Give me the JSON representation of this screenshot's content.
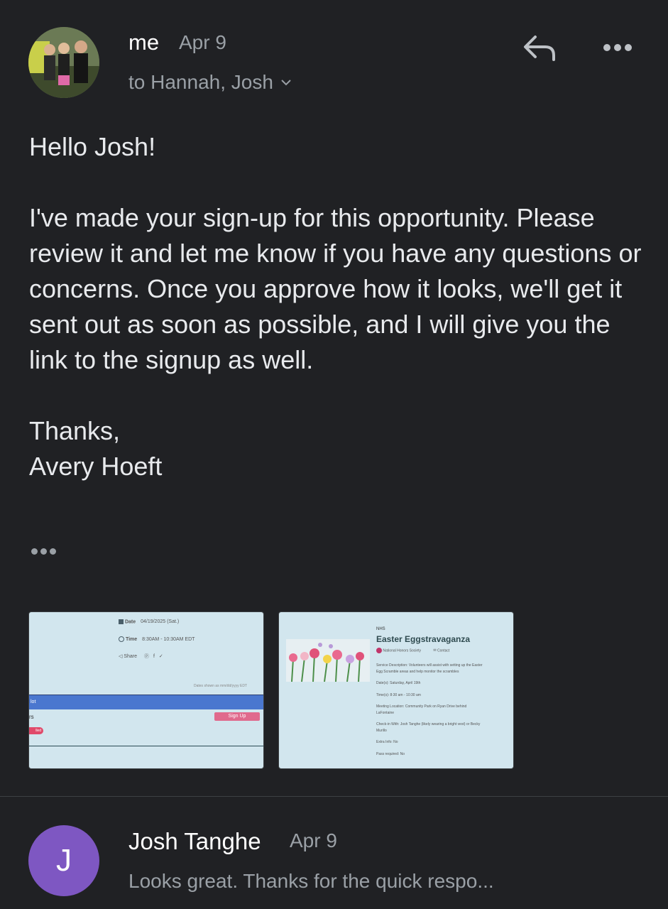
{
  "message": {
    "sender": "me",
    "date": "Apr 9",
    "recipients": "to Hannah, Josh",
    "greeting": "Hello Josh!",
    "body": "I've made your sign-up for this opportunity. Please review it and let me know if you have any questions or concerns. Once you approve how it looks, we'll get it sent out as soon as possible, and I will give you the link to the signup as well.",
    "closing": "Thanks,",
    "signature": "Avery Hoeft"
  },
  "attachment1": {
    "date_label": "Date",
    "date_value": "04/19/2025 (Sat.)",
    "time_label": "Time",
    "time_value": "8:30AM - 10:30AM EDT",
    "share_label": "Share",
    "dates_note": "Dates shown as mm/dd/yyyy EDT",
    "slot_label": "lot",
    "row_label": "rs",
    "signup_button": "Sign Up",
    "badge": "lled"
  },
  "attachment2": {
    "org": "NHS",
    "title": "Easter Eggstravaganza",
    "org_full": "National Honors Society",
    "contact": "Contact",
    "description": "Service Description: Volunteers will assist with setting up the Easter Egg Scramble areas and help monitor the scrambles",
    "dates": "Date(s): Saturday, April 19th",
    "times": "Time(s): 8:30 am - 10:30 am",
    "location": "Meeting Location: Community Park on Ryan Drive behind LaFontaine",
    "checkin": "Check-in With: Josh Tanghe (likely wearing a bright vest) or Becky Murillo",
    "extra": "Extra Info: No",
    "pass": "Pass required: No"
  },
  "reply": {
    "avatar_letter": "J",
    "sender": "Josh Tanghe",
    "date": "Apr 9",
    "snippet": "Looks great. Thanks for the quick respo..."
  },
  "colors": {
    "background": "#202124",
    "reply_avatar": "#7e57c2",
    "attachment_bg": "#d2e6ee",
    "slot_bar": "#4a77cf",
    "signup_button": "#e06a8d"
  }
}
